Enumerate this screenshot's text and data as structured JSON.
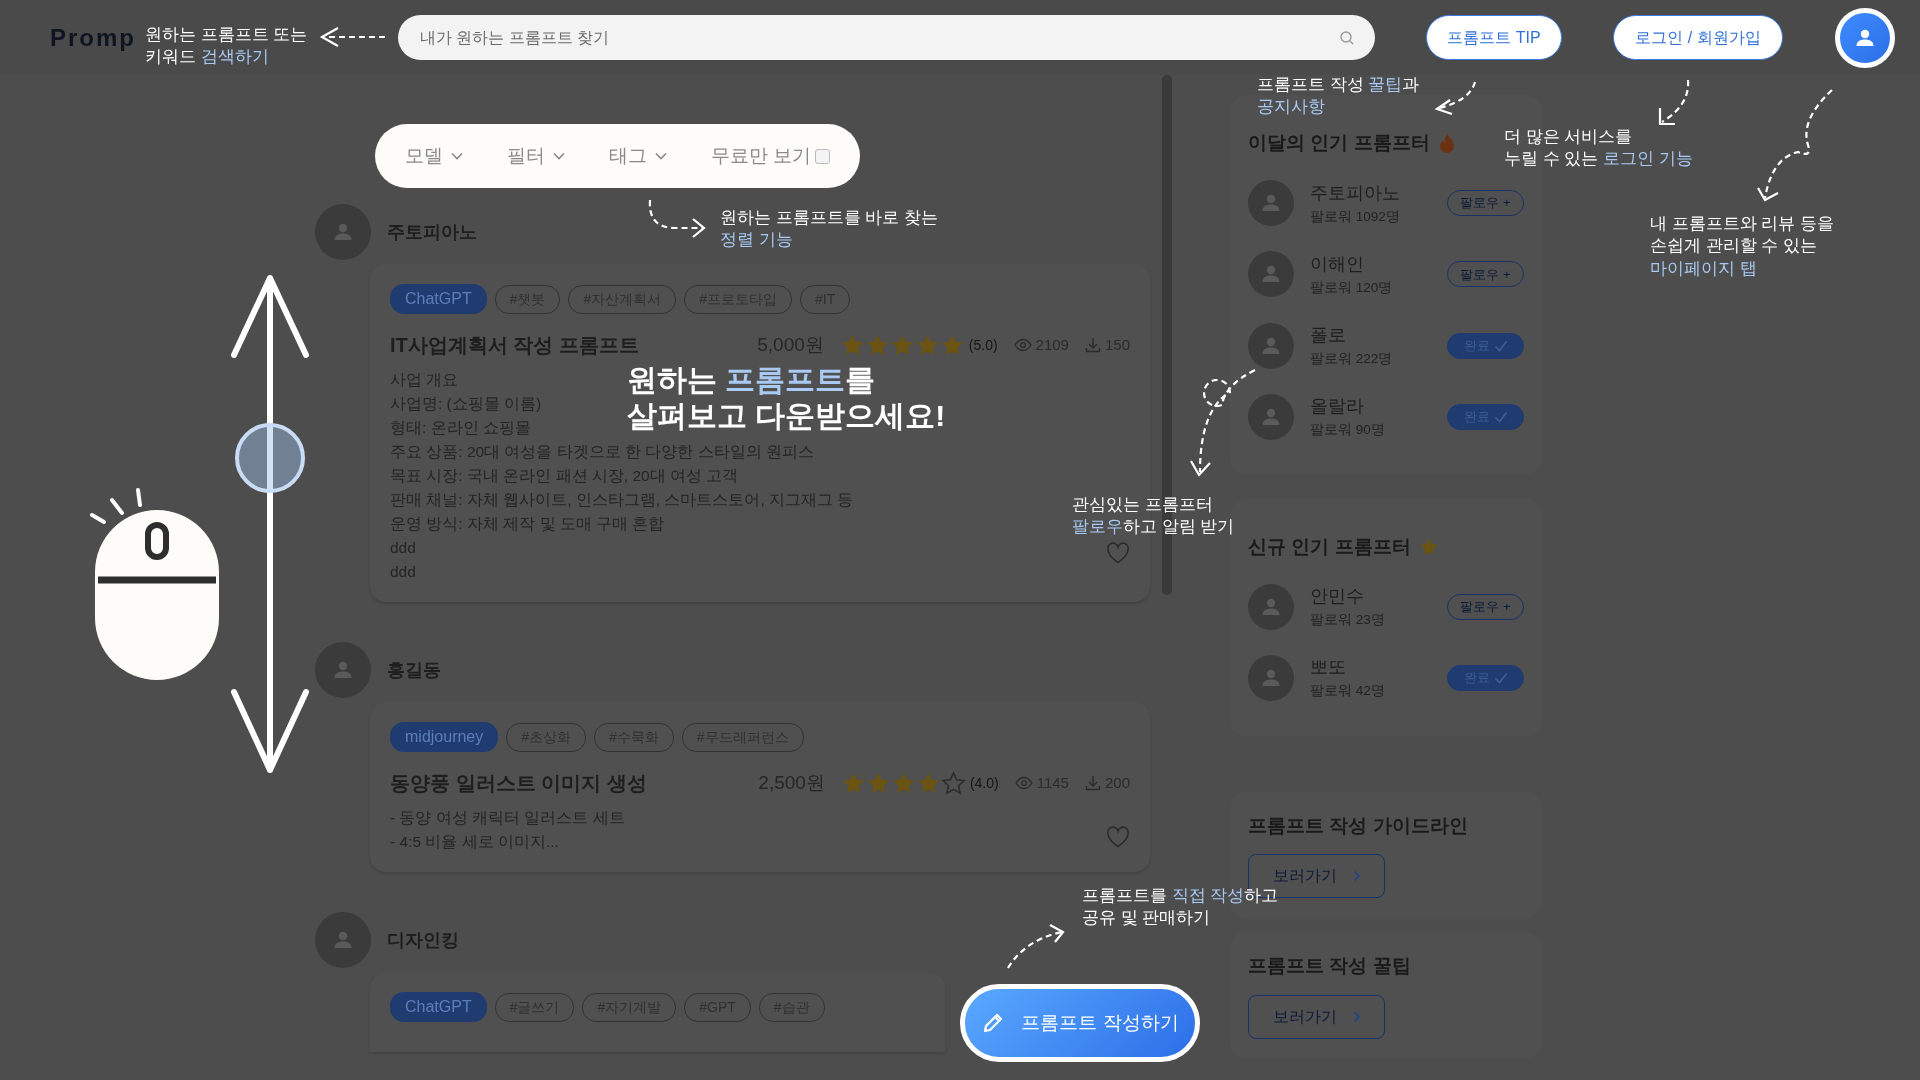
{
  "header": {
    "logo": "Promp",
    "search_placeholder": "내가 원하는 프롬프트 찾기",
    "buttons": [
      "프롬프트 TIP",
      "로그인 / 회원가입"
    ]
  },
  "filters": [
    {
      "kind": "dropdown",
      "label": "모델"
    },
    {
      "kind": "dropdown",
      "label": "필터"
    },
    {
      "kind": "dropdown",
      "label": "태그"
    },
    {
      "kind": "checkbox",
      "label": "무료만 보기",
      "checked": false
    }
  ],
  "posts": [
    {
      "author": "주토피아노",
      "model": "ChatGPT",
      "tags": [
        "#챗봇",
        "#자산계획서",
        "#프로토타입",
        "#IT"
      ],
      "title": "IT사업계획서 작성 프롬프트",
      "price": "5,000원",
      "stars": 5,
      "rating": "(5.0)",
      "views": "2109",
      "downloads": "150",
      "description": [
        "사업 개요",
        "사업명: (쇼핑몰 이름)",
        "형태: 온라인 쇼핑몰",
        "주요 상품: 20대 여성을 타겟으로 한 다양한 스타일의 원피스",
        "목표 시장: 국내 온라인 패션 시장, 20대 여성 고객",
        "판매 채널: 자체 웹사이트, 인스타그램, 스마트스토어, 지그재그 등",
        "운영 방식: 자체 제작 및 도매 구매 혼합",
        "ddd",
        "ddd"
      ]
    },
    {
      "author": "홍길동",
      "model": "midjourney",
      "tags": [
        "#초상화",
        "#수묵화",
        "#무드레퍼런스"
      ],
      "title": "동양풍 일러스트 이미지 생성",
      "price": "2,500원",
      "stars": 4,
      "rating": "(4.0)",
      "views": "1145",
      "downloads": "200",
      "description": [
        "- 동양 여성 캐릭터 일러스트 세트",
        "- 4:5 비율 세로 이미지..."
      ]
    },
    {
      "author": "디자인킹",
      "model": "ChatGPT",
      "tags": [
        "#글쓰기",
        "#자기계발",
        "#GPT",
        "#습관"
      ]
    }
  ],
  "sidebar": [
    {
      "kind": "users",
      "title": "이달의 인기 프롬프터",
      "users": [
        {
          "name": "주토피아노",
          "followers": "팔로워 1092명",
          "following": false,
          "button": "팔로우 +"
        },
        {
          "name": "이해인",
          "followers": "팔로워 120명",
          "following": false,
          "button": "팔로우 +"
        },
        {
          "name": "폴로",
          "followers": "팔로워 222명",
          "following": true,
          "button": "완료"
        },
        {
          "name": "올랄라",
          "followers": "팔로워 90명",
          "following": true,
          "button": "완료"
        }
      ]
    },
    {
      "kind": "users",
      "title": "신규 인기 프롬프터",
      "users": [
        {
          "name": "안민수",
          "followers": "팔로워 23명",
          "following": false,
          "button": "팔로우 +"
        },
        {
          "name": "뽀또",
          "followers": "팔로워 42명",
          "following": true,
          "button": "완료"
        }
      ]
    },
    {
      "kind": "link",
      "title": "프롬프트 작성 가이드라인",
      "button": "보러가기"
    },
    {
      "kind": "link",
      "title": "프롬프트 작성 꿀팁",
      "button": "보러가기"
    }
  ],
  "write_button": "프롬프트 작성하기",
  "guide": {
    "headline": "원하는 **프롬프트**를\n살펴보고 다운받으세요!",
    "notes": [
      "원하는 프롬프트 또는\n키워드 **검색하기**",
      "원하는 프롬프트를 바로 찾는\n**정렬 기능**",
      "프롬프트 작성 **꿀팁**과\n**공지사항**",
      "더 많은 서비스를\n누릴 수 있는 **로그인 기능**",
      "내 프롬프트와 리뷰 등을\n손쉽게 관리할 수 있는\n**마이페이지 탭**",
      "관심있는 프롬프터\n**팔로우**하고 알림 받기",
      "프롬프트를 **직접 작성**하고\n공유 및 판매하기"
    ]
  }
}
